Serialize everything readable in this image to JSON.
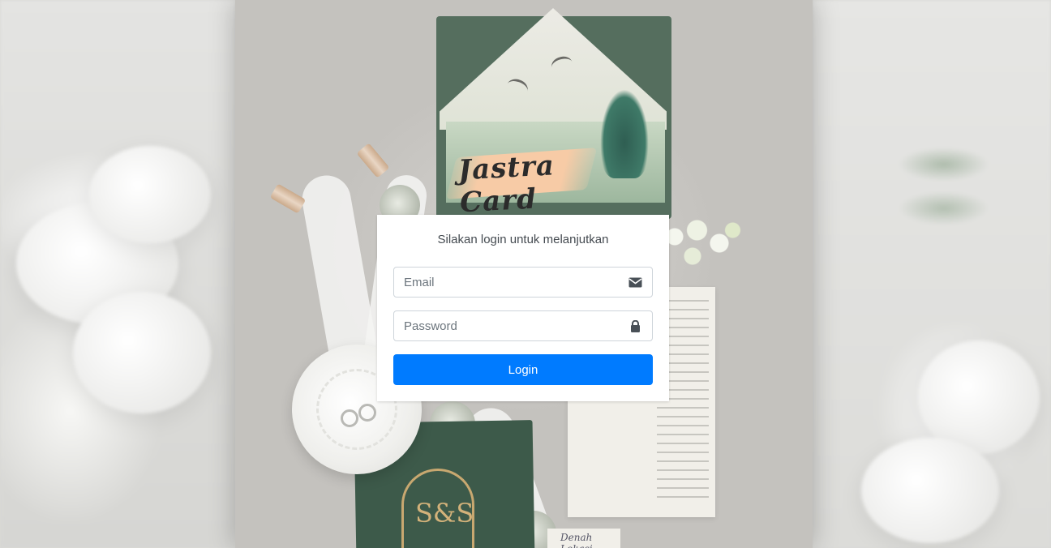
{
  "brand": {
    "logo_text": "Jastra Card"
  },
  "login": {
    "message": "Silakan login untuk melanjutkan",
    "email_placeholder": "Email",
    "password_placeholder": "Password",
    "submit_label": "Login",
    "email_icon": "envelope-icon",
    "password_icon": "lock-icon"
  },
  "background": {
    "monogram": "S&S",
    "map_label": "Denah Lokasi"
  },
  "colors": {
    "primary_button": "#007bff",
    "card_background": "#ffffff",
    "envelope_green": "#556e5e"
  }
}
